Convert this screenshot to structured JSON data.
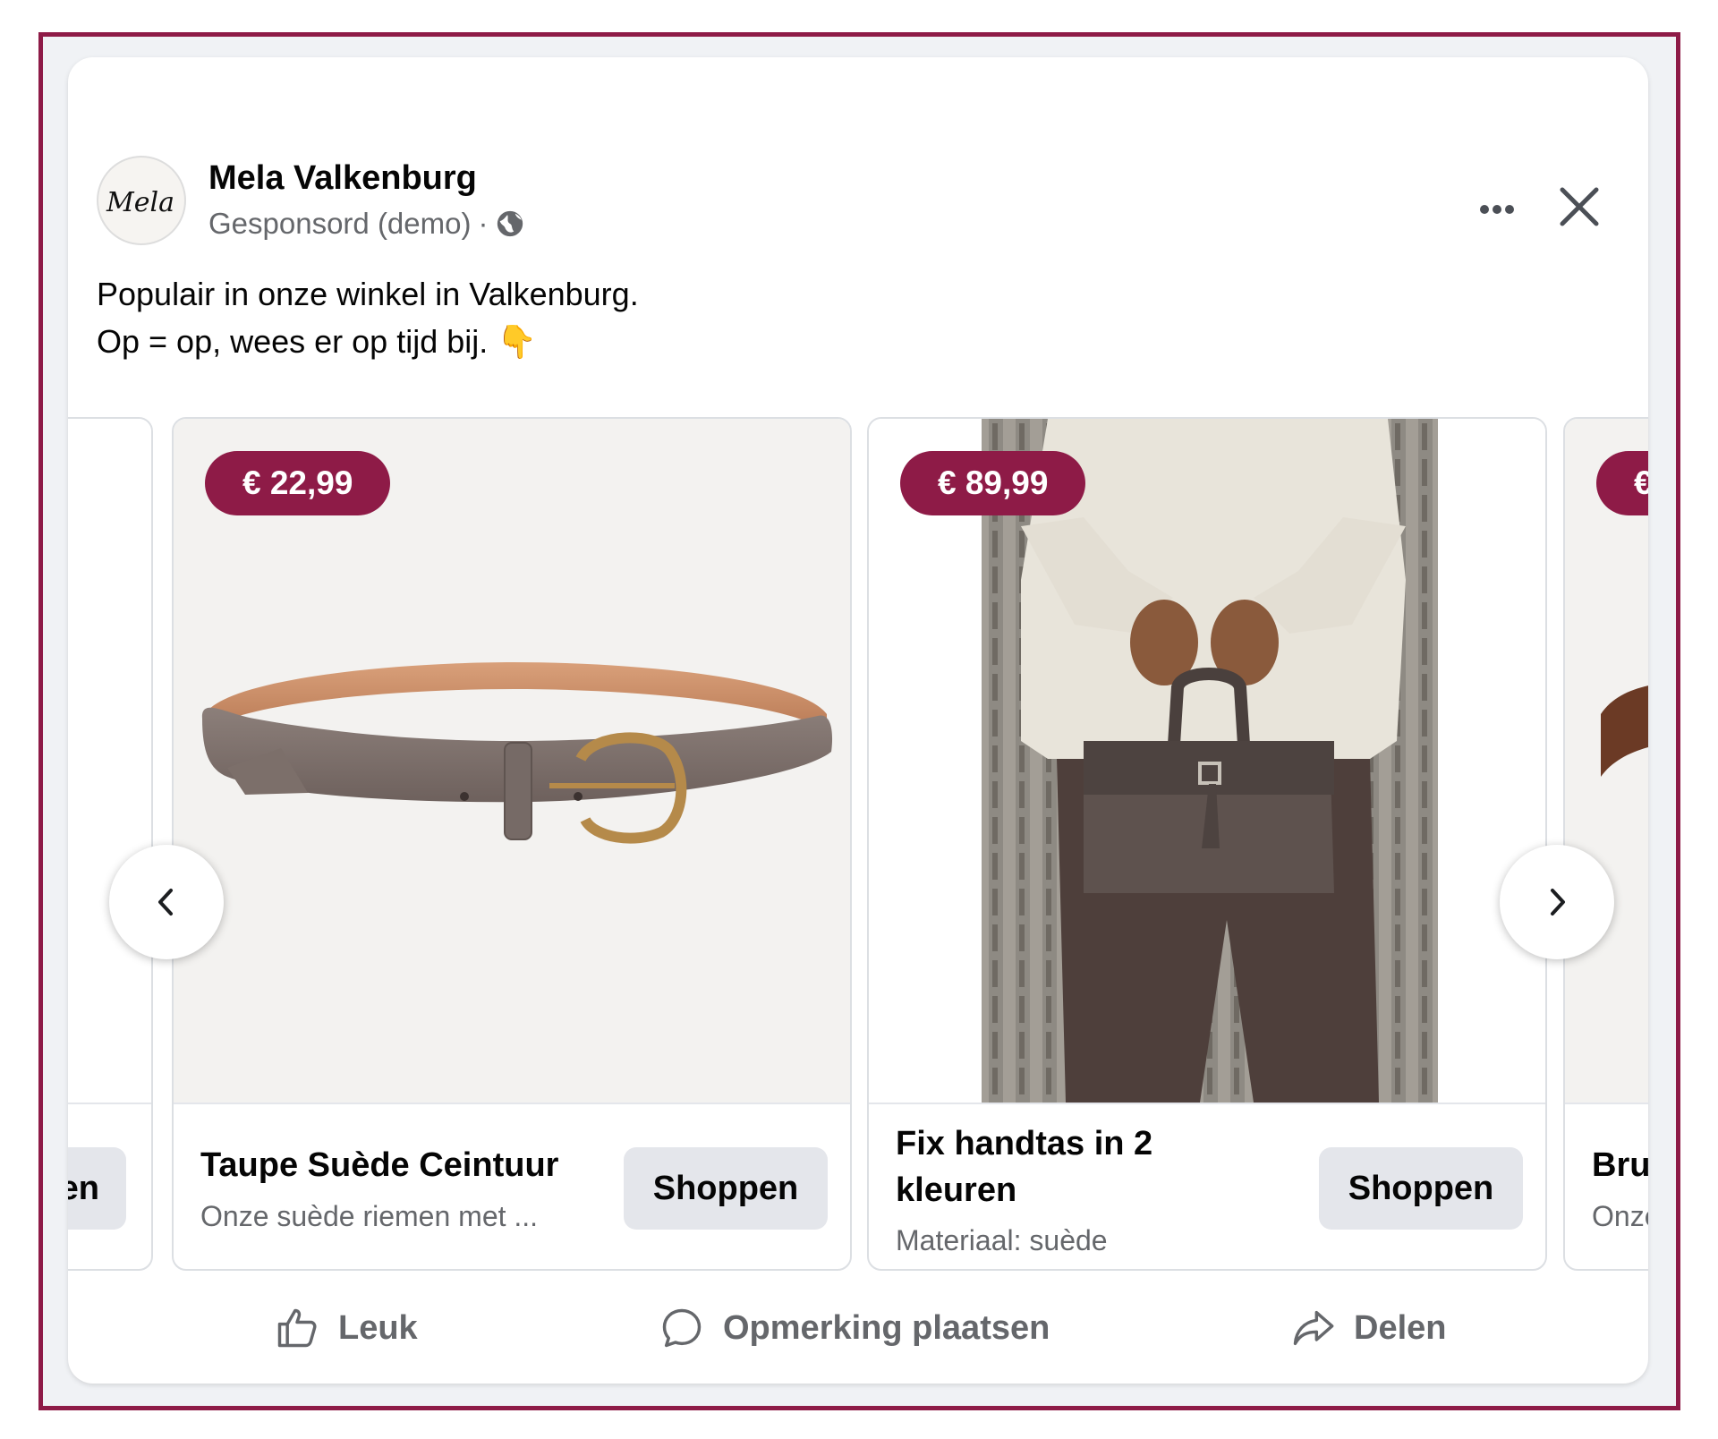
{
  "post": {
    "page_name": "Mela Valkenburg",
    "logo_text": "Mela",
    "sponsored": "Gesponsord (demo)",
    "separator": "·",
    "text_line1": "Populair in onze winkel in Valkenburg.",
    "text_line2": "Op = op, wees er op tijd bij.",
    "emoji": "👇"
  },
  "carousel": {
    "prev_partial": {
      "cta_fragment": "en"
    },
    "items": [
      {
        "price": "€ 22,99",
        "title": "Taupe Suède Ceintuur",
        "description": "Onze suède riemen met ...",
        "cta": "Shoppen"
      },
      {
        "price": "€ 89,99",
        "title_line1": "Fix handtas in 2",
        "title_line2": "kleuren",
        "description": "Materiaal: suède",
        "cta": "Shoppen"
      }
    ],
    "next_partial": {
      "price_fragment": "€",
      "title_fragment": "Brui",
      "desc_fragment": "Onze"
    }
  },
  "actions": {
    "like": "Leuk",
    "comment": "Opmerking plaatsen",
    "share": "Delen"
  },
  "colors": {
    "brand": "#8e1b47",
    "secondary_text": "#65676b",
    "button_bg": "#e4e6eb"
  },
  "icons": [
    "globe-icon",
    "more-options-icon",
    "close-icon",
    "chevron-left-icon",
    "chevron-right-icon",
    "like-icon",
    "comment-icon",
    "share-icon"
  ]
}
